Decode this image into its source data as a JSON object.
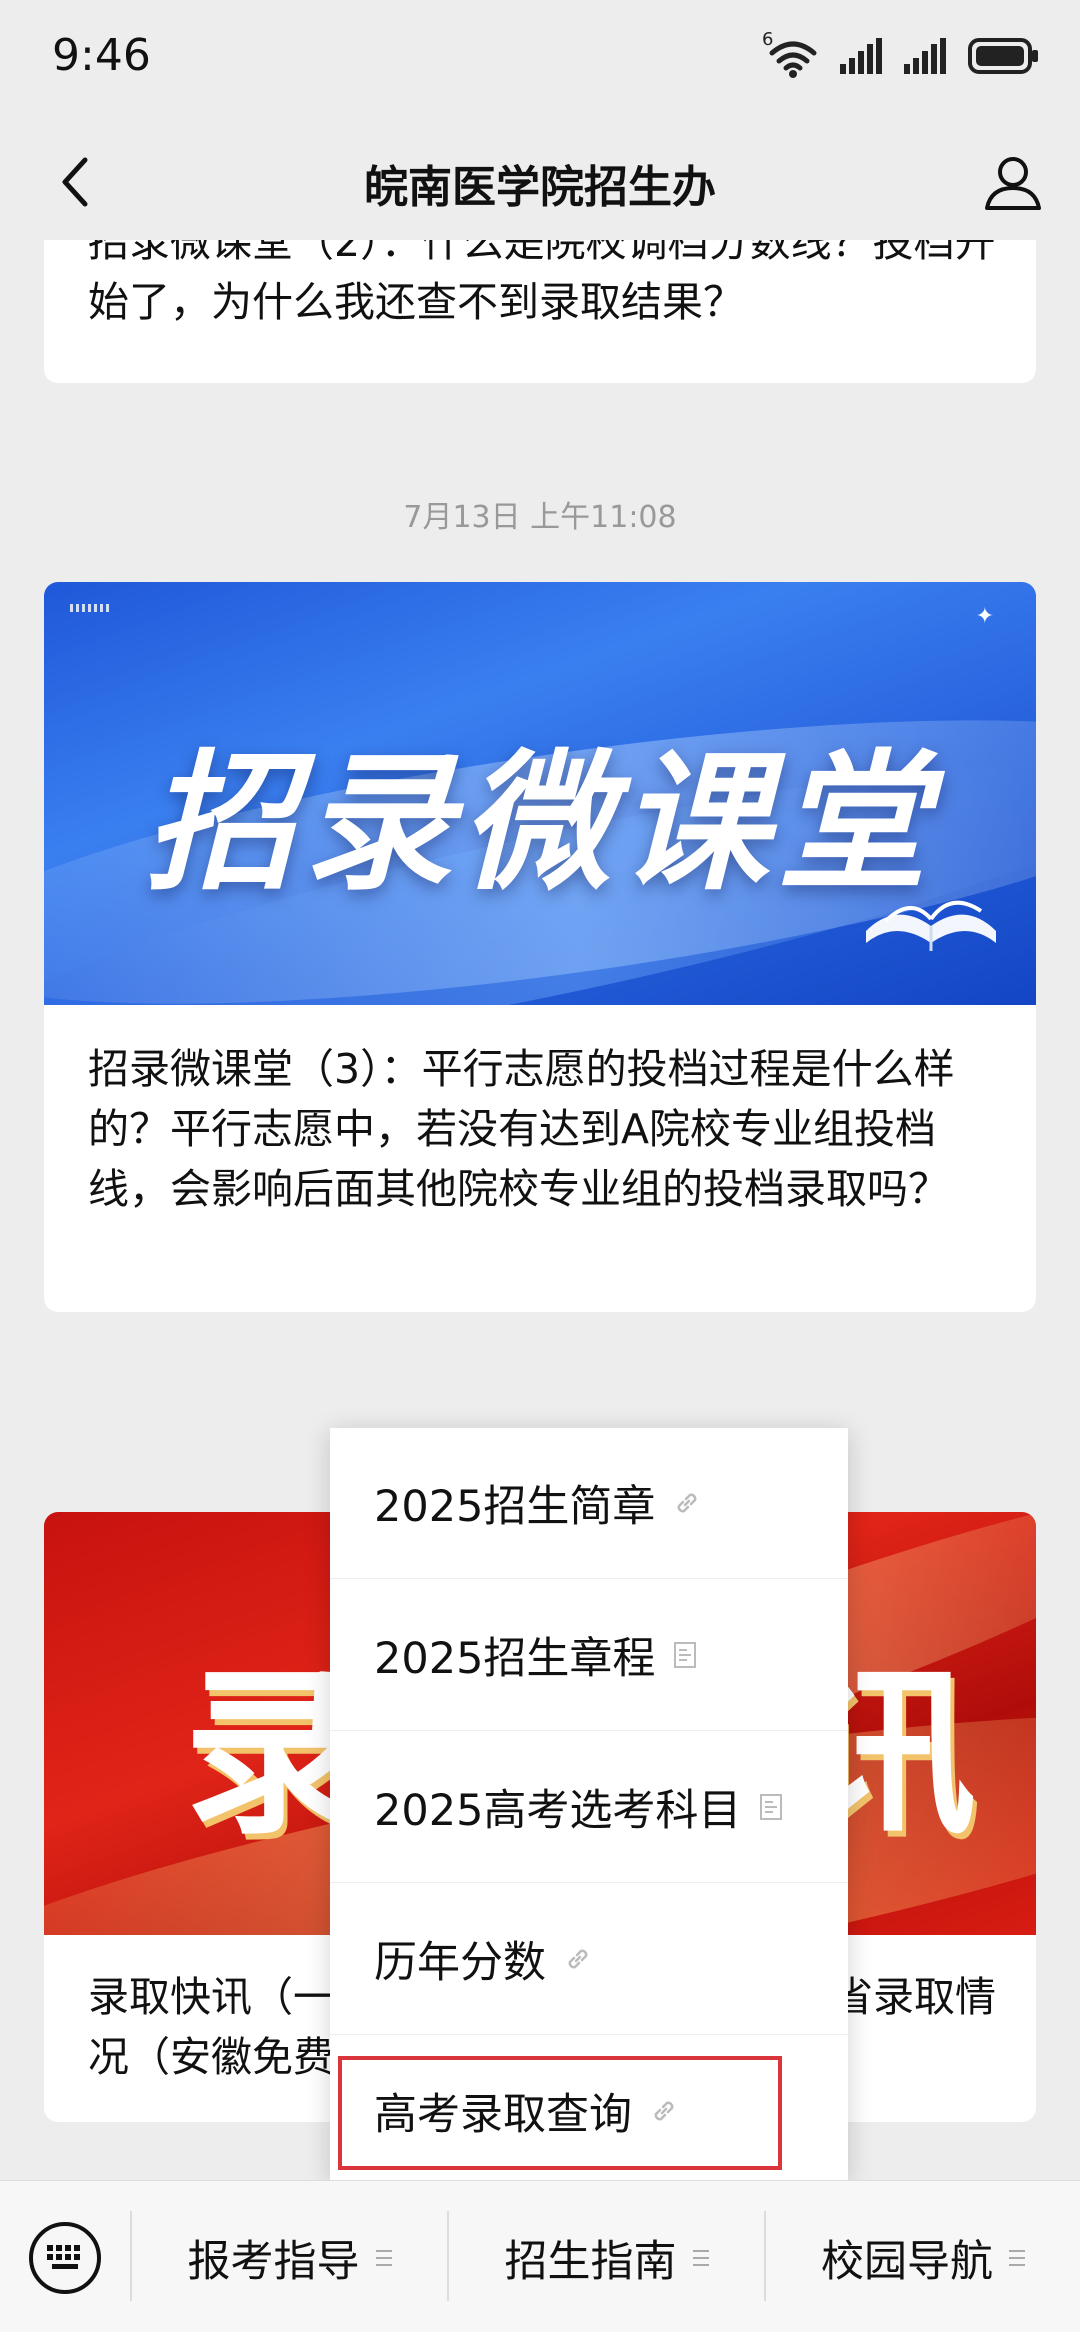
{
  "status_bar": {
    "time": "9:46",
    "wifi_badge": "6"
  },
  "header": {
    "title": "皖南医学院招生办"
  },
  "articles": [
    {
      "text": "招录微课堂（2）：什么是院校调档分数线？投档开始了，为什么我还查不到录取结果？"
    },
    {
      "timestamp": "7月13日 上午11:08",
      "banner_text": "招录微课堂",
      "text": "招录微课堂（3）：平行志愿的投档过程是什么样的？平行志愿中，若没有达到A院校专业组投档线，会影响后面其他院校专业组的投档录取吗？"
    },
    {
      "banner_text_left": "录",
      "banner_text_right": "讯",
      "text_left": "录取快讯（一",
      "text_right": "省录取情",
      "text_line2": "况（安徽免费"
    }
  ],
  "popup_menu": {
    "items": [
      {
        "label": "2025招生简章",
        "icon": "link-icon"
      },
      {
        "label": "2025招生章程",
        "icon": "article-icon"
      },
      {
        "label": "2025高考选考科目",
        "icon": "article-icon"
      },
      {
        "label": "历年分数",
        "icon": "link-icon"
      },
      {
        "label": "高考录取查询",
        "icon": "link-icon"
      }
    ],
    "highlight_color": "#d9353a"
  },
  "bottom_menu": {
    "items": [
      {
        "label": "报考指导"
      },
      {
        "label": "招生指南"
      },
      {
        "label": "校园导航"
      }
    ]
  }
}
